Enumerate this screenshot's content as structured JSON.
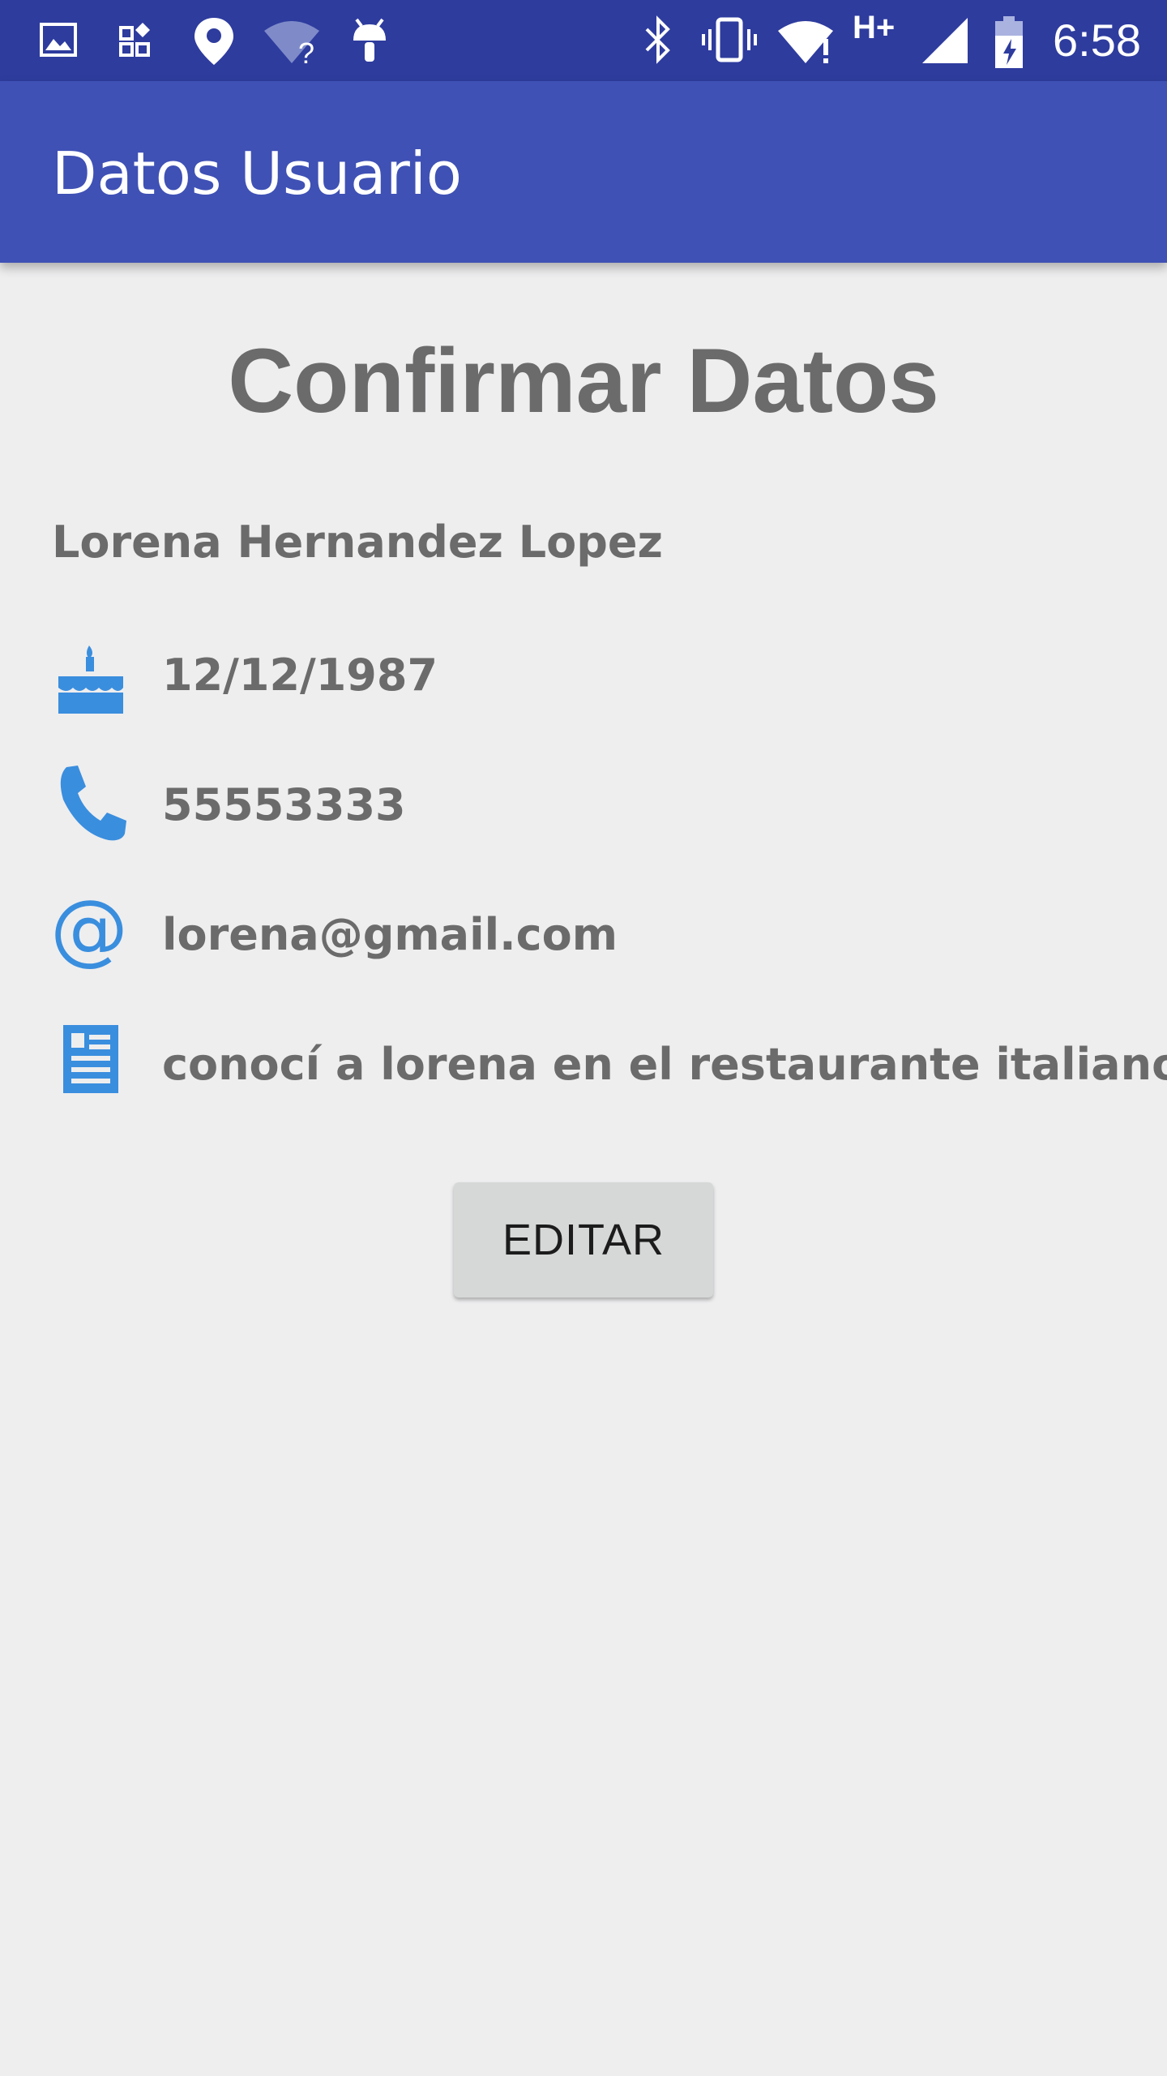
{
  "status_bar": {
    "time": "6:58",
    "network_label": "H+",
    "icons": [
      "image-icon",
      "apps-icon",
      "location-pin-icon",
      "wifi-unknown-icon",
      "android-icon",
      "bluetooth-icon",
      "vibrate-icon",
      "wifi-alert-icon",
      "signal-icon",
      "battery-charging-icon"
    ]
  },
  "app_bar": {
    "title": "Datos Usuario"
  },
  "main": {
    "heading": "Confirmar Datos",
    "name": "Lorena Hernandez Lopez",
    "details": [
      {
        "icon": "cake-icon",
        "value": "12/12/1987"
      },
      {
        "icon": "phone-icon",
        "value": "55553333"
      },
      {
        "icon": "at-sign-icon",
        "value": "lorena@gmail.com"
      },
      {
        "icon": "description-icon",
        "value": "conocí a lorena en el restaurante italiano"
      }
    ],
    "edit_label": "EDITAR"
  },
  "colors": {
    "status_bar": "#2e3c9e",
    "app_bar": "#3f51b5",
    "icon_accent": "#3a8ede",
    "text": "#6b6b6b",
    "background": "#eeeeef",
    "button": "#d6d7d7"
  }
}
